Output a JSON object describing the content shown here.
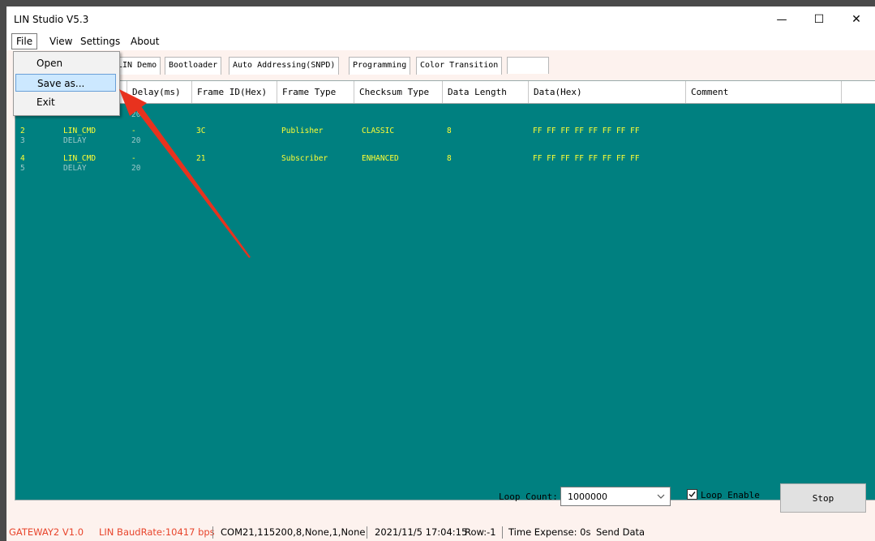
{
  "window": {
    "title": "LIN Studio V5.3",
    "minimize": "—",
    "maximize": "☐",
    "close": "✕"
  },
  "menubar": [
    "File",
    "View",
    "Settings",
    "About"
  ],
  "file_menu": [
    "Open",
    "Save as...",
    "Exit"
  ],
  "tabs": [
    "LIN Demo",
    "Bootloader",
    "Auto Addressing(SNPD)",
    "Programming",
    "Color Transition"
  ],
  "columns": [
    "Delay(ms)",
    "Frame ID(Hex)",
    "Frame Type",
    "Checksum Type",
    "Data Length",
    "Data(Hex)",
    "Comment"
  ],
  "rows": [
    {
      "idx": "",
      "type": "",
      "delay": "20",
      "id": "",
      "frame": "",
      "checksum": "",
      "len": "",
      "data": "",
      "kind": "delay"
    },
    {
      "idx": "2",
      "type": "LIN_CMD",
      "delay": "-",
      "id": "3C",
      "frame": "Publisher",
      "checksum": "CLASSIC",
      "len": "8",
      "data": "FF FF FF FF FF FF FF FF",
      "kind": "cmd"
    },
    {
      "idx": "3",
      "type": "DELAY",
      "delay": "20",
      "id": "",
      "frame": "",
      "checksum": "",
      "len": "",
      "data": "",
      "kind": "delay"
    },
    {
      "idx": "4",
      "type": "LIN_CMD",
      "delay": "-",
      "id": "21",
      "frame": "Subscriber",
      "checksum": "ENHANCED",
      "len": "8",
      "data": "FF FF FF FF FF FF FF FF",
      "kind": "cmd"
    },
    {
      "idx": "5",
      "type": "DELAY",
      "delay": "20",
      "id": "",
      "frame": "",
      "checksum": "",
      "len": "",
      "data": "",
      "kind": "delay"
    }
  ],
  "loop": {
    "label": "Loop Count:",
    "value": "1000000",
    "enable_label": "Loop Enable",
    "enabled": true,
    "stop_label": "Stop"
  },
  "status": {
    "gateway": "GATEWAY2  V1.0",
    "baud": "LIN BaudRate:10417 bps",
    "com": "COM21,115200,8,None,1,None",
    "time": "2021/11/5 17:04:15",
    "row": "Row:-1",
    "expense": "Time Expense: 0s",
    "action": "Send Data"
  },
  "colors": {
    "grid": "#008080",
    "cmd_text": "#ffff33",
    "delay_text": "#9cc8c8",
    "status_red": "#e8452c",
    "annotation_arrow": "#e8321e"
  }
}
